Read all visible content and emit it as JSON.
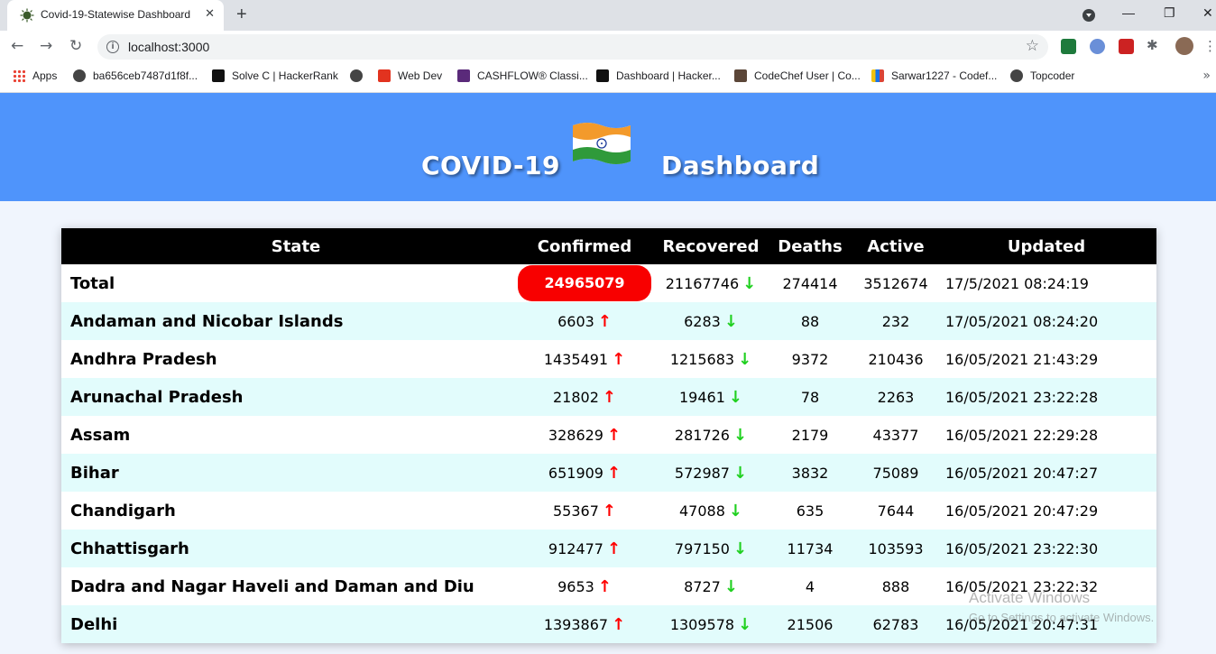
{
  "browser": {
    "tab_title": "Covid-19-Statewise Dashboard",
    "url": "localhost:3000",
    "bookmarks": [
      {
        "label": "Apps"
      },
      {
        "label": "ba656ceb7487d1f8f..."
      },
      {
        "label": "Solve C | HackerRank"
      },
      {
        "label": ""
      },
      {
        "label": "Web Dev"
      },
      {
        "label": "CASHFLOW® Classi..."
      },
      {
        "label": "Dashboard | Hacker..."
      },
      {
        "label": "CodeChef User | Co..."
      },
      {
        "label": "Sarwar1227 - Codef..."
      },
      {
        "label": "Topcoder"
      }
    ]
  },
  "header": {
    "title_left": "COVID-19",
    "title_right": "Dashboard"
  },
  "table": {
    "columns": [
      "State",
      "Confirmed",
      "Recovered",
      "Deaths",
      "Active",
      "Updated"
    ],
    "rows": [
      {
        "state": "Total",
        "confirmed": "24965079",
        "recovered": "21167746",
        "deaths": "274414",
        "active": "3512674",
        "updated": "17/5/2021 08:24:19"
      },
      {
        "state": "Andaman and Nicobar Islands",
        "confirmed": "6603",
        "recovered": "6283",
        "deaths": "88",
        "active": "232",
        "updated": "17/05/2021 08:24:20"
      },
      {
        "state": "Andhra Pradesh",
        "confirmed": "1435491",
        "recovered": "1215683",
        "deaths": "9372",
        "active": "210436",
        "updated": "16/05/2021 21:43:29"
      },
      {
        "state": "Arunachal Pradesh",
        "confirmed": "21802",
        "recovered": "19461",
        "deaths": "78",
        "active": "2263",
        "updated": "16/05/2021 23:22:28"
      },
      {
        "state": "Assam",
        "confirmed": "328629",
        "recovered": "281726",
        "deaths": "2179",
        "active": "43377",
        "updated": "16/05/2021 22:29:28"
      },
      {
        "state": "Bihar",
        "confirmed": "651909",
        "recovered": "572987",
        "deaths": "3832",
        "active": "75089",
        "updated": "16/05/2021 20:47:27"
      },
      {
        "state": "Chandigarh",
        "confirmed": "55367",
        "recovered": "47088",
        "deaths": "635",
        "active": "7644",
        "updated": "16/05/2021 20:47:29"
      },
      {
        "state": "Chhattisgarh",
        "confirmed": "912477",
        "recovered": "797150",
        "deaths": "11734",
        "active": "103593",
        "updated": "16/05/2021 23:22:30"
      },
      {
        "state": "Dadra and Nagar Haveli and Daman and Diu",
        "confirmed": "9653",
        "recovered": "8727",
        "deaths": "4",
        "active": "888",
        "updated": "16/05/2021 23:22:32"
      },
      {
        "state": "Delhi",
        "confirmed": "1393867",
        "recovered": "1309578",
        "deaths": "21506",
        "active": "62783",
        "updated": "16/05/2021 20:47:31"
      }
    ]
  },
  "watermark": {
    "line1": "Activate Windows",
    "line2": "Go to Settings to activate Windows."
  },
  "colors": {
    "header_bg": "#4f94fb",
    "up_arrow": "#ff0000",
    "down_arrow": "#20d020",
    "total_pill": "#f80000"
  }
}
